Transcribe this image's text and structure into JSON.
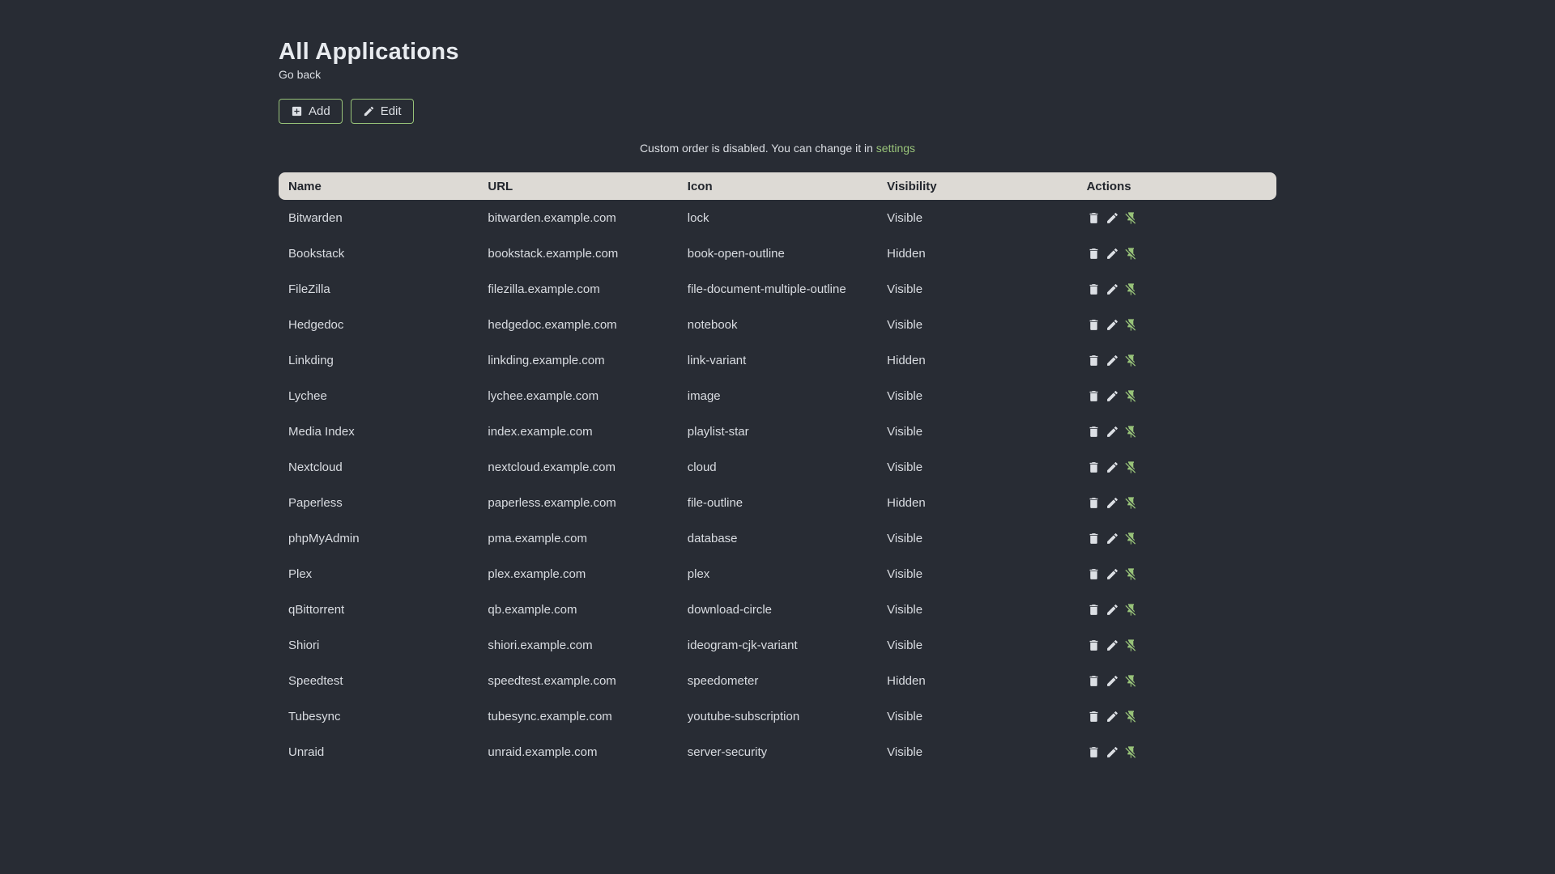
{
  "page": {
    "title": "All Applications",
    "go_back_label": "Go back",
    "notice": {
      "text_before": "Custom order is disabled. You can change it in ",
      "link_label": "settings"
    }
  },
  "toolbar": {
    "add_label": "Add",
    "edit_label": "Edit",
    "add_icon": "plus-box",
    "edit_icon": "pencil"
  },
  "table": {
    "headers": [
      "Name",
      "URL",
      "Icon",
      "Visibility",
      "Actions"
    ],
    "row_action_icons": [
      "trash-can",
      "pencil",
      "pin-off"
    ],
    "rows": [
      {
        "name": "Bitwarden",
        "url": "bitwarden.example.com",
        "icon": "lock",
        "visibility": "Visible"
      },
      {
        "name": "Bookstack",
        "url": "bookstack.example.com",
        "icon": "book-open-outline",
        "visibility": "Hidden"
      },
      {
        "name": "FileZilla",
        "url": "filezilla.example.com",
        "icon": "file-document-multiple-outline",
        "visibility": "Visible"
      },
      {
        "name": "Hedgedoc",
        "url": "hedgedoc.example.com",
        "icon": "notebook",
        "visibility": "Visible"
      },
      {
        "name": "Linkding",
        "url": "linkding.example.com",
        "icon": "link-variant",
        "visibility": "Hidden"
      },
      {
        "name": "Lychee",
        "url": "lychee.example.com",
        "icon": "image",
        "visibility": "Visible"
      },
      {
        "name": "Media Index",
        "url": "index.example.com",
        "icon": "playlist-star",
        "visibility": "Visible"
      },
      {
        "name": "Nextcloud",
        "url": "nextcloud.example.com",
        "icon": "cloud",
        "visibility": "Visible"
      },
      {
        "name": "Paperless",
        "url": "paperless.example.com",
        "icon": "file-outline",
        "visibility": "Hidden"
      },
      {
        "name": "phpMyAdmin",
        "url": "pma.example.com",
        "icon": "database",
        "visibility": "Visible"
      },
      {
        "name": "Plex",
        "url": "plex.example.com",
        "icon": "plex",
        "visibility": "Visible"
      },
      {
        "name": "qBittorrent",
        "url": "qb.example.com",
        "icon": "download-circle",
        "visibility": "Visible"
      },
      {
        "name": "Shiori",
        "url": "shiori.example.com",
        "icon": "ideogram-cjk-variant",
        "visibility": "Visible"
      },
      {
        "name": "Speedtest",
        "url": "speedtest.example.com",
        "icon": "speedometer",
        "visibility": "Hidden"
      },
      {
        "name": "Tubesync",
        "url": "tubesync.example.com",
        "icon": "youtube-subscription",
        "visibility": "Visible"
      },
      {
        "name": "Unraid",
        "url": "unraid.example.com",
        "icon": "server-security",
        "visibility": "Visible"
      }
    ]
  },
  "colors": {
    "background": "#282c34",
    "text": "#dcdfe4",
    "accent": "#98c379",
    "table_header_bg": "#dddad5",
    "table_header_text": "#22262d"
  }
}
